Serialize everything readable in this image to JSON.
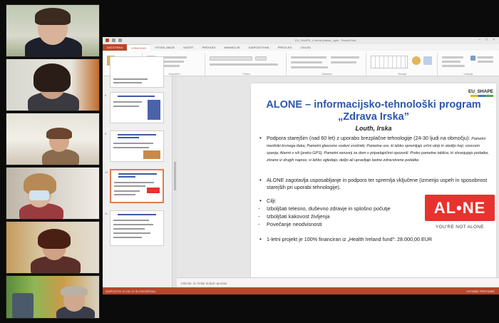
{
  "window": {
    "title": "EU_SHAPE_1 dobra praksa_.pptx - PowerPoint"
  },
  "ribbon_tabs": [
    "DATOTEKA",
    "OSNOVNO",
    "VSTAVLJANJE",
    "NAČRT",
    "PREHODI",
    "ANIMACIJE",
    "DIAPOZITIVNA",
    "PREGLED",
    "OGLED"
  ],
  "ribbon_groups": [
    "Odložišče",
    "Diapozitivi",
    "Pisava",
    "Odstavek",
    "Risanje",
    "Urejanje"
  ],
  "colors": {
    "accent": "#b7472a",
    "title_blue": "#2a57b0",
    "alone_red": "#e8322f"
  },
  "thumbnails": {
    "numbers": [
      "8",
      "9",
      "10",
      "11"
    ],
    "selected": "10"
  },
  "slide": {
    "logo": "EU_SHAPE",
    "title": "ALONE – informacijsko-tehnološki program „Zdrava Irska”",
    "subtitle": "Louth, Irska",
    "bullet1_main": "Podpora starejšim (nad 60 let) z uporabo brezplačne tehnologije (24-30 ljudi na območju):",
    "bullet1_detail": "Pametni merilniki krvnega tlaka; Pametni glasovno vodeni zvočniki; Pametne ure, ki lahko spremljajo srčni utrip in sledijo hoji, vzorcem spanja; Alarmi v sili (preko GPS); Pametni senzorji za dom s pripadajočimi opozorili. Preko pametne tablice, ki shranjujejo podatke, zbrane iz drugih naprav, si lahko ogledajo, delijo ali upravljajo lastne zdravstvene podatke.",
    "bullet2": "ALONE zagotavlja usposabljanje in podporo ter spremlja vključene (izmerijo uspeh in sposobnost starejših pri uporabi tehnologije).",
    "goals_label": "Cilji:",
    "goals": [
      "Izboljšati telesno, duševno zdravje in splošno počutje",
      "Izboljšati kakovost življenja",
      "Povečanje neodvisnosti"
    ],
    "bullet4": "1-letni projekt je 100% financiran iz „Health Ireland fund”: 28.000,00 EUR",
    "alone_logo": "AL•NE",
    "alone_tagline": "YOU'RE NOT ALONE"
  },
  "notes_placeholder": "Kliknite, če želite dodati opombe",
  "status": {
    "left": "DIAPOZITIV 10 OD 13   SLOVENŠČINA",
    "right": "OPOMBE   PRIPOMBE"
  }
}
